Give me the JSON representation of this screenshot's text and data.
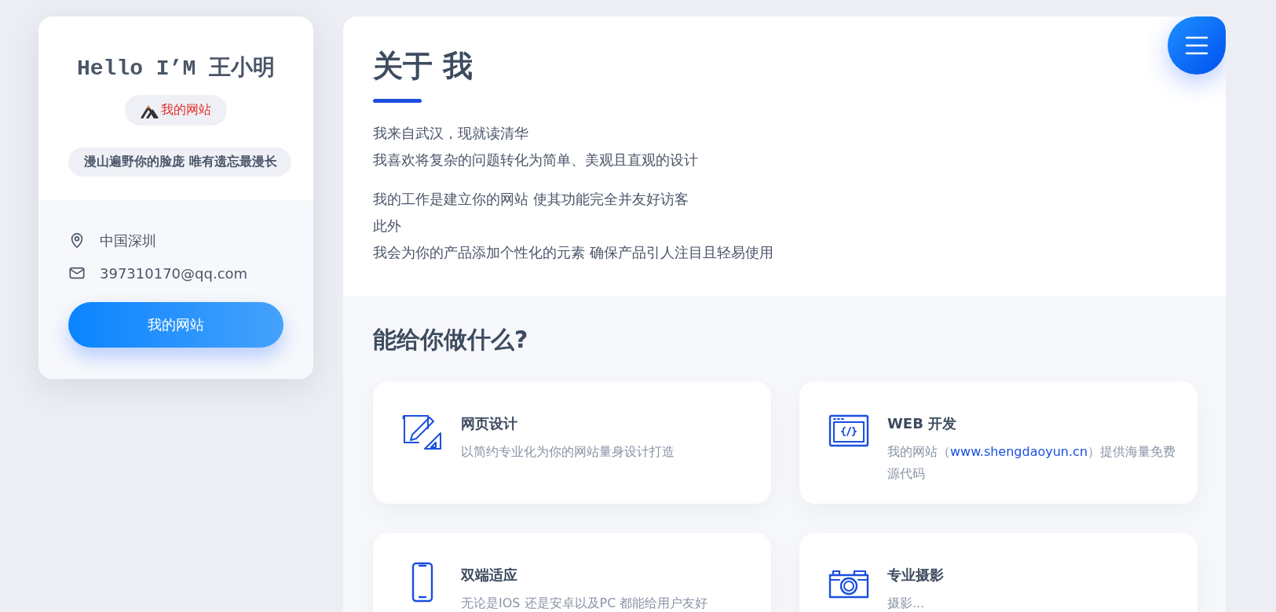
{
  "profile": {
    "greeting": "Hello I’M 王小明",
    "badge": "我的网站",
    "motto": "漫山遍野你的脸庞 唯有遗忘最漫长",
    "contacts": [
      {
        "kind": "location",
        "text": "中国深圳"
      },
      {
        "kind": "email",
        "text": "397310170@qq.com"
      }
    ],
    "button": "我的网站"
  },
  "about": {
    "title": "关于 我",
    "paragraphs": [
      [
        "我来自武汉，现就读清华",
        "我喜欢将复杂的问题转化为简单、美观且直观的设计"
      ],
      [
        "我的工作是建立你的网站 使其功能完全并友好访客",
        "此外",
        "我会为你的产品添加个性化的元素 确保产品引人注目且轻易使用"
      ]
    ]
  },
  "services": {
    "title": "能给你做什么?",
    "items": [
      {
        "title": "网页设计",
        "description": "以简约专业化为你的网站量身设计打造"
      },
      {
        "title": "WEB 开发",
        "description": "我的网站（",
        "link": "www.shengdaoyun.cn",
        "description_after": "）提供海量免费源代码"
      },
      {
        "title": "双端适应",
        "description": "无论是IOS 还是安卓以及PC 都能给用户友好"
      },
      {
        "title": "专业摄影",
        "description": "摄影..."
      }
    ]
  }
}
